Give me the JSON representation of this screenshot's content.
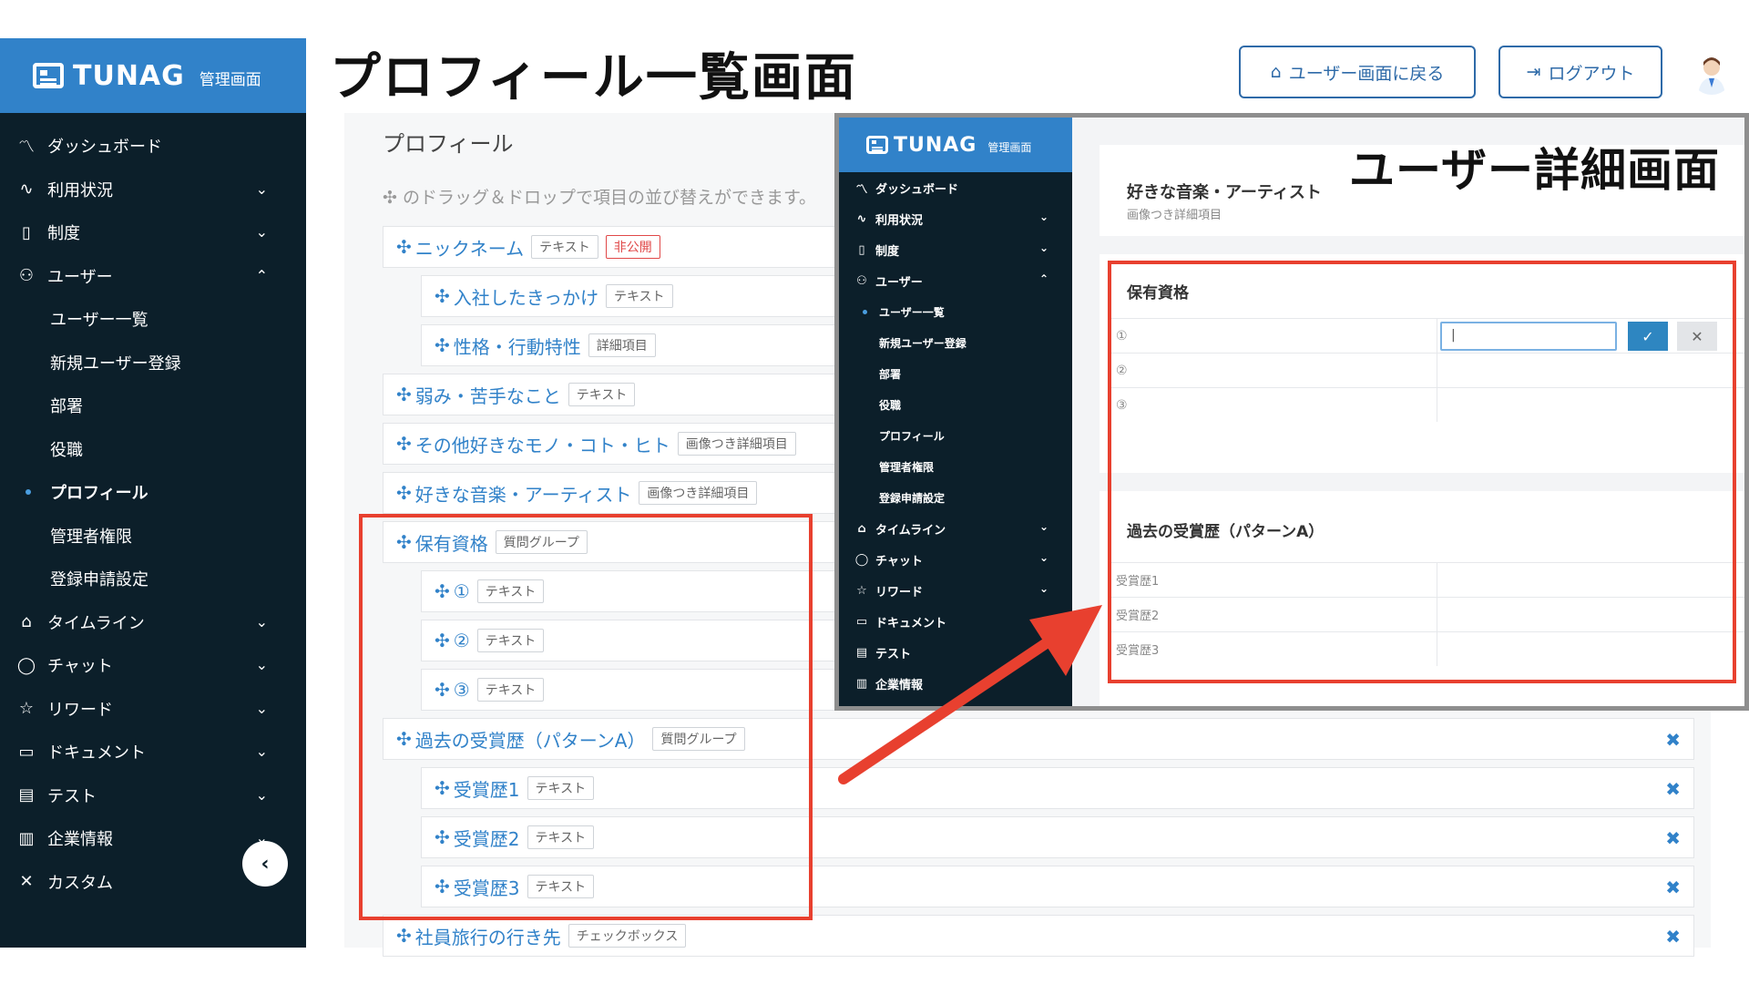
{
  "header": {
    "logo_text": "TUNAG",
    "logo_sub": "管理画面",
    "page_heading": "プロフィール一覧画面",
    "back_button": "ユーザー画面に戻る",
    "logout_button": "ログアウト"
  },
  "sidebar": {
    "items": [
      {
        "icon": "chart-line-icon",
        "glyph": "〽",
        "label": "ダッシュボード",
        "chevron": ""
      },
      {
        "icon": "pulse-icon",
        "glyph": "∿",
        "label": "利用状況",
        "chevron": "⌄"
      },
      {
        "icon": "book-icon",
        "glyph": "▯",
        "label": "制度",
        "chevron": "⌄"
      },
      {
        "icon": "users-icon",
        "glyph": "⚇",
        "label": "ユーザー",
        "chevron": "⌃"
      }
    ],
    "user_sub_items": [
      "ユーザー一覧",
      "新規ユーザー登録",
      "部署",
      "役職",
      "プロフィール",
      "管理者権限",
      "登録申請設定"
    ],
    "active_sub": "プロフィール",
    "items_after": [
      {
        "icon": "home-icon",
        "glyph": "⌂",
        "label": "タイムライン",
        "chevron": "⌄"
      },
      {
        "icon": "chat-icon",
        "glyph": "◯",
        "label": "チャット",
        "chevron": "⌄"
      },
      {
        "icon": "star-icon",
        "glyph": "☆",
        "label": "リワード",
        "chevron": "⌄"
      },
      {
        "icon": "folder-icon",
        "glyph": "▭",
        "label": "ドキュメント",
        "chevron": "⌄"
      },
      {
        "icon": "checklist-icon",
        "glyph": "▤",
        "label": "テスト",
        "chevron": "⌄"
      },
      {
        "icon": "building-icon",
        "glyph": "▥",
        "label": "企業情報",
        "chevron": "⌄"
      },
      {
        "icon": "tools-icon",
        "glyph": "✕",
        "label": "カスタム",
        "chevron": ""
      }
    ]
  },
  "main": {
    "section_title": "プロフィール",
    "hint": "✣ のドラッグ＆ドロップで項目の並び替えができます。",
    "rows": [
      {
        "label": "ニックネーム",
        "tag": "テキスト",
        "tag2": "非公開"
      },
      {
        "label": "入社したきっかけ",
        "tag": "テキスト"
      },
      {
        "label": "性格・行動特性",
        "tag": "詳細項目"
      },
      {
        "label": "弱み・苦手なこと",
        "tag": "テキスト"
      },
      {
        "label": "その他好きなモノ・コト・ヒト",
        "tag": "画像つき詳細項目"
      },
      {
        "label": "好きな音楽・アーティスト",
        "tag": "画像つき詳細項目"
      },
      {
        "label": "保有資格",
        "tag": "質問グループ"
      },
      {
        "label": "①",
        "tag": "テキスト"
      },
      {
        "label": "②",
        "tag": "テキスト"
      },
      {
        "label": "③",
        "tag": "テキスト"
      },
      {
        "label": "過去の受賞歴（パターンA）",
        "tag": "質問グループ"
      },
      {
        "label": "受賞歴1",
        "tag": "テキスト"
      },
      {
        "label": "受賞歴2",
        "tag": "テキスト"
      },
      {
        "label": "受賞歴3",
        "tag": "テキスト"
      },
      {
        "label": "社員旅行の行き先",
        "tag": "チェックボックス"
      }
    ],
    "delete_glyph": "✖"
  },
  "inset": {
    "title": "ユーザー詳細画面",
    "logo_text": "TUNAG",
    "logo_sub": "管理画面",
    "side_items": [
      {
        "icon": "chart-line-icon",
        "glyph": "〽",
        "label": "ダッシュボード",
        "chevron": ""
      },
      {
        "icon": "pulse-icon",
        "glyph": "∿",
        "label": "利用状況",
        "chevron": "⌄"
      },
      {
        "icon": "book-icon",
        "glyph": "▯",
        "label": "制度",
        "chevron": "⌄"
      },
      {
        "icon": "users-icon",
        "glyph": "⚇",
        "label": "ユーザー",
        "chevron": "⌃"
      }
    ],
    "side_sub": [
      "ユーザー一覧",
      "新規ユーザー登録",
      "部署",
      "役職",
      "プロフィール",
      "管理者権限",
      "登録申請設定"
    ],
    "side_items_after": [
      {
        "icon": "home-icon",
        "glyph": "⌂",
        "label": "タイムライン",
        "chevron": "⌄"
      },
      {
        "icon": "chat-icon",
        "glyph": "◯",
        "label": "チャット",
        "chevron": "⌄"
      },
      {
        "icon": "star-icon",
        "glyph": "☆",
        "label": "リワード",
        "chevron": "⌄"
      },
      {
        "icon": "folder-icon",
        "glyph": "▭",
        "label": "ドキュメント",
        "chevron": "⌄"
      },
      {
        "icon": "checklist-icon",
        "glyph": "▤",
        "label": "テスト",
        "chevron": ""
      },
      {
        "icon": "building-icon",
        "glyph": "▥",
        "label": "企業情報",
        "chevron": ""
      }
    ],
    "music_title": "好きな音楽・アーティスト",
    "music_sub": "画像つき詳細項目",
    "qual_title": "保有資格",
    "qual_rows": [
      "①",
      "②",
      "③"
    ],
    "qual_input_value": "|",
    "award_title": "過去の受賞歴（パターンA）",
    "award_rows": [
      "受賞歴1",
      "受賞歴2",
      "受賞歴3"
    ],
    "ok_glyph": "✓",
    "cancel_glyph": "✕"
  },
  "colors": {
    "accent": "#3182c9",
    "sidebar": "#0c1f2a",
    "highlight": "#e8402f"
  }
}
